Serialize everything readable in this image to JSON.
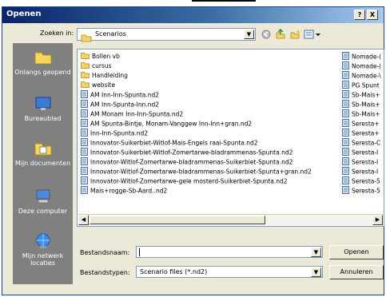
{
  "window": {
    "title": "Openen",
    "help_label": "?",
    "close_label": "X"
  },
  "lookin": {
    "label": "Zoeken in:",
    "value": "Scenarios"
  },
  "places": [
    {
      "label": "Onlangs geopend"
    },
    {
      "label": "Bureaublad"
    },
    {
      "label": "Mijn documenten"
    },
    {
      "label": "Deze computer"
    },
    {
      "label": "Mijn netwerk locaties"
    }
  ],
  "files_left": [
    {
      "name": "Bollen vb",
      "type": "folder"
    },
    {
      "name": "cursus",
      "type": "folder"
    },
    {
      "name": "Handleiding",
      "type": "folder"
    },
    {
      "name": "website",
      "type": "folder"
    },
    {
      "name": "AM Inn-Inn-Spunta.nd2",
      "type": "file"
    },
    {
      "name": "AM Inn-Spunta-Inn.nd2",
      "type": "file"
    },
    {
      "name": "AM Monam Inn-Inn-Spunta.nd2",
      "type": "file"
    },
    {
      "name": "AM Spunta-Bintje, Monam-Vanggew Inn-Inn+gran.nd2",
      "type": "file"
    },
    {
      "name": "Inn-Inn-Spunta.nd2",
      "type": "file"
    },
    {
      "name": "Innovator-Suikerbiet-Witlof-Mais-Engels raai-Spunta.nd2",
      "type": "file"
    },
    {
      "name": "Innovator-Suikerbiet-Witlof-Zomertarwe-bladrammenas-Spunta.nd2",
      "type": "file"
    },
    {
      "name": "Innovator-Witlof-Zomertarwe-bladrammenas-Suikerbiet-Spunta.nd2",
      "type": "file"
    },
    {
      "name": "Innovator-Witlof-Zomertarwe-bladrammenas-Suikerbiet-Spunta+gran.nd2",
      "type": "file"
    },
    {
      "name": "Innovator-Witlof-Zomertarwe-gele mosterd-Suikerbiet-Spunta.nd2",
      "type": "file"
    },
    {
      "name": "Mais+rogge-Sb-Aard..nd2",
      "type": "file"
    }
  ],
  "files_right": [
    {
      "name": "Nomade-("
    },
    {
      "name": "Nomade-("
    },
    {
      "name": "Nomade-\\"
    },
    {
      "name": "PG Spunt"
    },
    {
      "name": "Sb-Mais+"
    },
    {
      "name": "Sb-Mais+"
    },
    {
      "name": "Sb-Mais+"
    },
    {
      "name": "Seresta+"
    },
    {
      "name": "Seresta+"
    },
    {
      "name": "Seresta-C"
    },
    {
      "name": "Seresta-I"
    },
    {
      "name": "Seresta-I"
    },
    {
      "name": "Seresta-I"
    },
    {
      "name": "Seresta-5"
    },
    {
      "name": "Seresta-5"
    }
  ],
  "filename": {
    "label": "Bestandsnaam:",
    "value": ""
  },
  "filetype": {
    "label": "Bestandstypen:",
    "value": "Scenario files (*.nd2)"
  },
  "buttons": {
    "open": "Openen",
    "cancel": "Annuleren"
  },
  "colors": {
    "title_start": "#0a246a",
    "title_end": "#a6caf0",
    "places_bg": "#808080",
    "dialog_bg": "#ece9d8"
  }
}
